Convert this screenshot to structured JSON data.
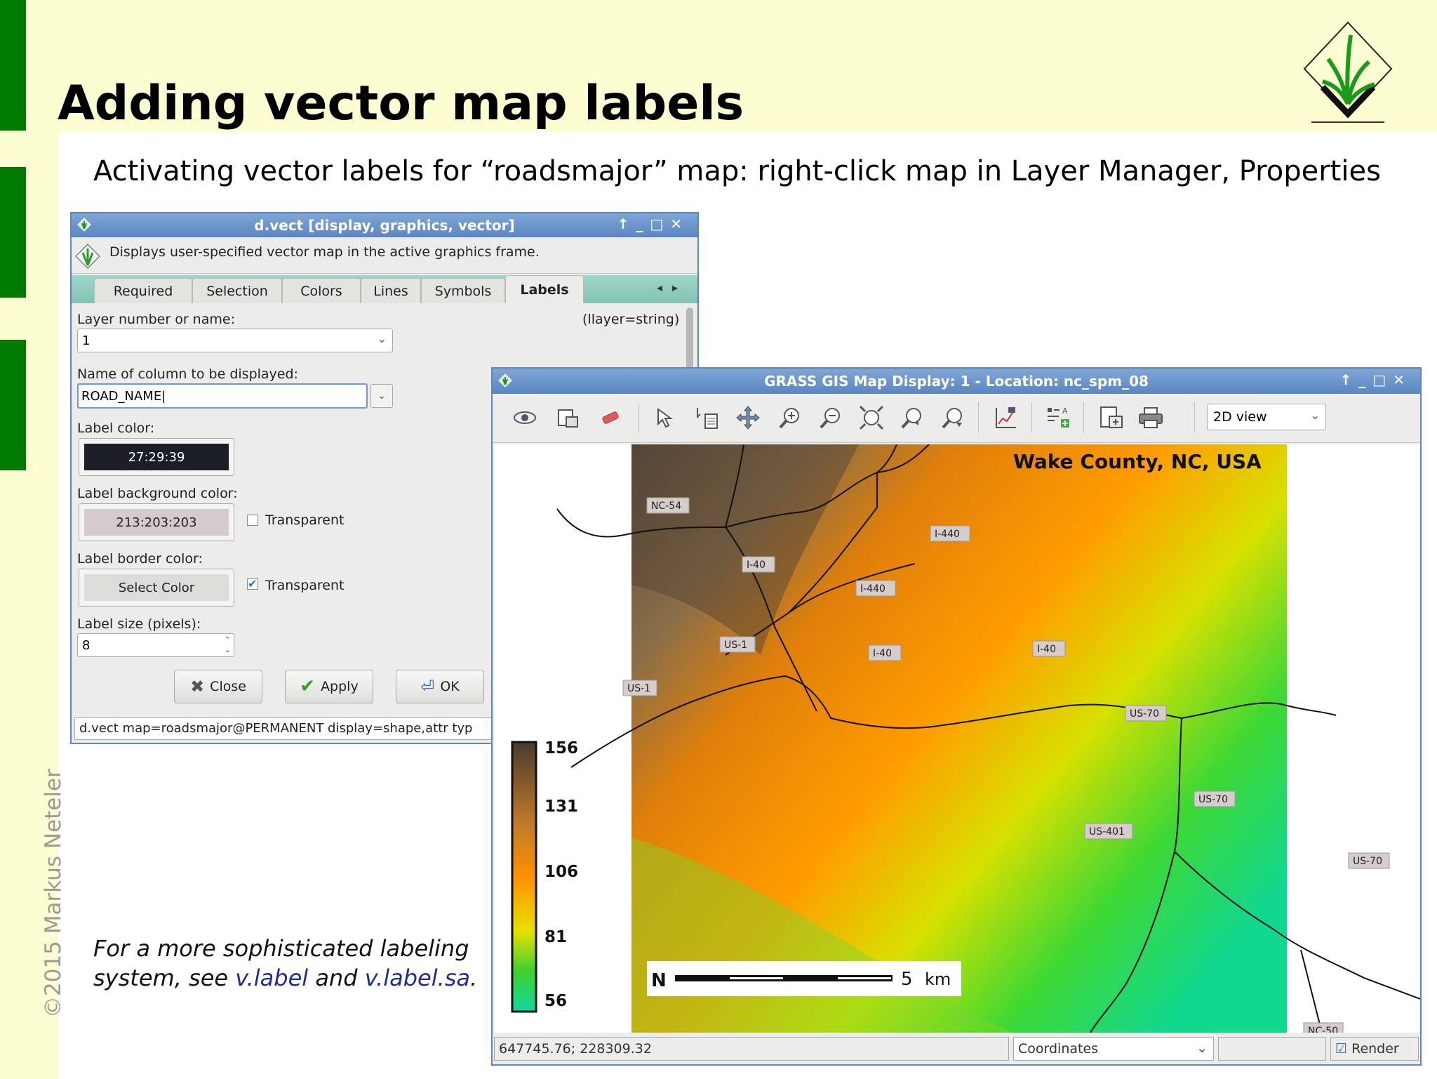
{
  "slide": {
    "title": "Adding vector map labels",
    "subtitle": "Activating vector labels for “roadsmajor” map: right-click map in Layer Manager, Properties",
    "copyright": "©2015 Markus Neteler",
    "note_line1": "For a more sophisticated labeling",
    "note_line2_pre": "system, see ",
    "note_link1": "v.label",
    "note_mid": " and ",
    "note_link2": "v.label.sa",
    "note_end": ".",
    "colors": {
      "slide_bg": "#fdfdd2",
      "side_bar": "#007a00",
      "link": "#1f2b9a"
    }
  },
  "dvect": {
    "title": "d.vect [display, graphics, vector]",
    "description": "Displays user-specified vector map in the active graphics frame.",
    "tabs": [
      "Required",
      "Selection",
      "Colors",
      "Lines",
      "Symbols",
      "Labels"
    ],
    "active_tab": "Labels",
    "layer_label": "Layer number or name:",
    "layer_hint": "(llayer=string)",
    "layer_value": "1",
    "column_label": "Name of column to be displayed:",
    "column_value": "ROAD_NAME",
    "label_color_label": "Label color:",
    "label_color_value": "27:29:39",
    "bg_color_label": "Label background color:",
    "bg_color_value": "213:203:203",
    "bg_transparent_label": "Transparent",
    "bg_transparent_checked": false,
    "border_color_label": "Label border color:",
    "border_color_value": "Select Color",
    "border_transparent_label": "Transparent",
    "border_transparent_checked": true,
    "size_label": "Label size (pixels):",
    "size_value": "8",
    "buttons": {
      "close": "Close",
      "apply": "Apply",
      "ok": "OK"
    },
    "command": "d.vect map=roadsmajor@PERMANENT display=shape,attr typ",
    "colors": {
      "label_color": "#1b1d27",
      "bg_color": "#d5cbcb"
    }
  },
  "mapdisplay": {
    "title": "GRASS GIS Map Display: 1  - Location: nc_spm_08",
    "view_mode": "2D view",
    "map_title": "Wake County, NC, USA",
    "legend_ticks": [
      "156",
      "131",
      "106",
      "81",
      "56"
    ],
    "scale_value": "5",
    "scale_unit": "km",
    "road_labels": [
      "NC-54",
      "I-440",
      "I-40",
      "I-440",
      "US-1",
      "I-40",
      "I-40",
      "US-1",
      "US-70",
      "US-70",
      "US-401",
      "US-70",
      "NC-50"
    ],
    "status_coords": "647745.76; 228309.32",
    "status_mode": "Coordinates",
    "render_label": "Render",
    "render_checked": true,
    "toolbar_icons": [
      "eye-icon",
      "add-layer-icon",
      "eraser-icon",
      "pointer-icon",
      "query-icon",
      "pan-icon",
      "zoom-in-icon",
      "zoom-out-icon",
      "zoom-extent-icon",
      "zoom-back-icon",
      "zoom-menu-icon",
      "analyze-icon",
      "decoration-icon",
      "save-icon",
      "print-icon"
    ]
  }
}
